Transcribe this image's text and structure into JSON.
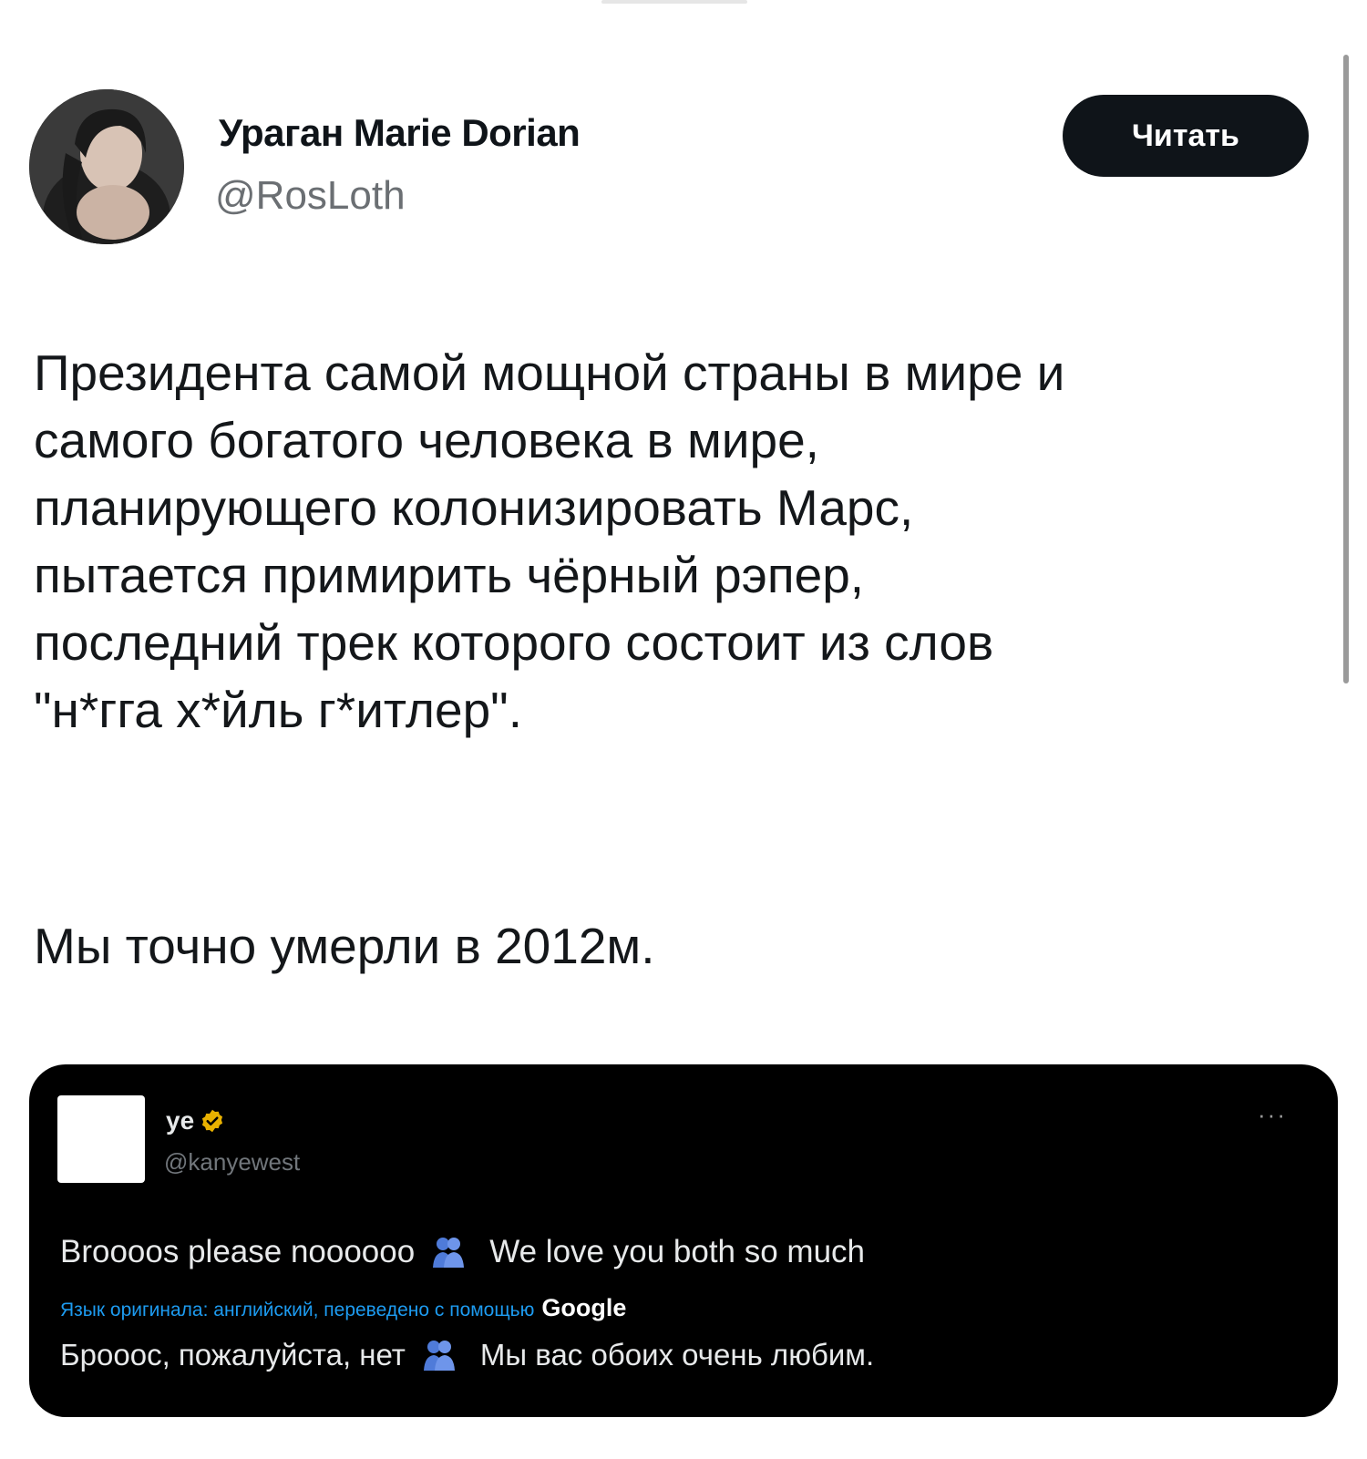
{
  "post": {
    "author_name": "Ураган Marie Dorian",
    "author_handle": "@RosLoth",
    "follow_label": "Читать",
    "text_lines": [
      "Президента самой мощной страны в мире и",
      "самого богатого человека в мире,",
      "планирующего колонизировать Марс,",
      "пытается примирить чёрный рэпер,",
      "последний трек которого состоит из слов",
      "\"н*гга х*йль г*итлер\"."
    ],
    "text_last": "Мы точно умерли в 2012м."
  },
  "embed": {
    "name": "ye",
    "handle": "@kanyewest",
    "more": "···",
    "text_part1": "Broooos please noooooo",
    "text_part2": "We love you both so much",
    "translate_note": "Язык оригинала: английский, переведено с помощью",
    "translate_brand": "Google",
    "translated_part1": "Брооос, пожалуйста, нет",
    "translated_part2": "Мы вас обоих очень любим.",
    "icons": {
      "verified": "verified-badge-icon",
      "hug": "people-hugging-icon"
    },
    "colors": {
      "verified": "#e8b100",
      "link": "#1d9bf0",
      "hug": "#4f7bd9"
    }
  }
}
